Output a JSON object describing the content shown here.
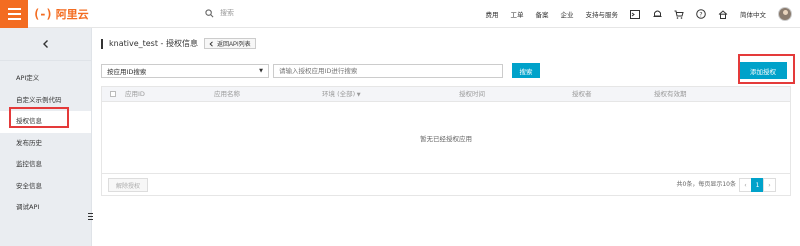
{
  "topbar": {
    "logo_mark": "(-)",
    "logo_text": "阿里云",
    "search_placeholder": "搜索",
    "nav": [
      "费用",
      "工单",
      "备案",
      "企业",
      "支持与服务"
    ],
    "language": "简体中文",
    "icons": [
      "terminal-icon",
      "bell-icon",
      "cart-icon",
      "help-icon",
      "home-icon"
    ]
  },
  "sidebar": {
    "items": [
      {
        "label": "API定义",
        "active": false
      },
      {
        "label": "自定义示例代码",
        "active": false
      },
      {
        "label": "授权信息",
        "active": true
      },
      {
        "label": "发布历史",
        "active": false
      },
      {
        "label": "监控信息",
        "active": false
      },
      {
        "label": "安全信息",
        "active": false
      },
      {
        "label": "调试API",
        "active": false
      }
    ]
  },
  "header": {
    "title": "knative_test - 授权信息",
    "back_label": "返回API列表",
    "add_label": "添加授权"
  },
  "filter": {
    "select_value": "按应用ID搜索",
    "input_placeholder": "请输入授权应用ID进行搜索",
    "search_label": "搜索"
  },
  "table": {
    "columns": [
      "应用ID",
      "应用名称",
      "环境 (全部)",
      "授权时间",
      "授权者",
      "授权有效期"
    ],
    "empty_text": "暂无已经授权应用"
  },
  "footer": {
    "revoke_label": "解除授权",
    "pager_info": "共0条，每页显示10条",
    "prev": "‹",
    "current_page": "1",
    "next": "›"
  },
  "colors": {
    "brand": "#f36c21",
    "accent": "#00a2ca",
    "highlight": "#e43a3a"
  }
}
